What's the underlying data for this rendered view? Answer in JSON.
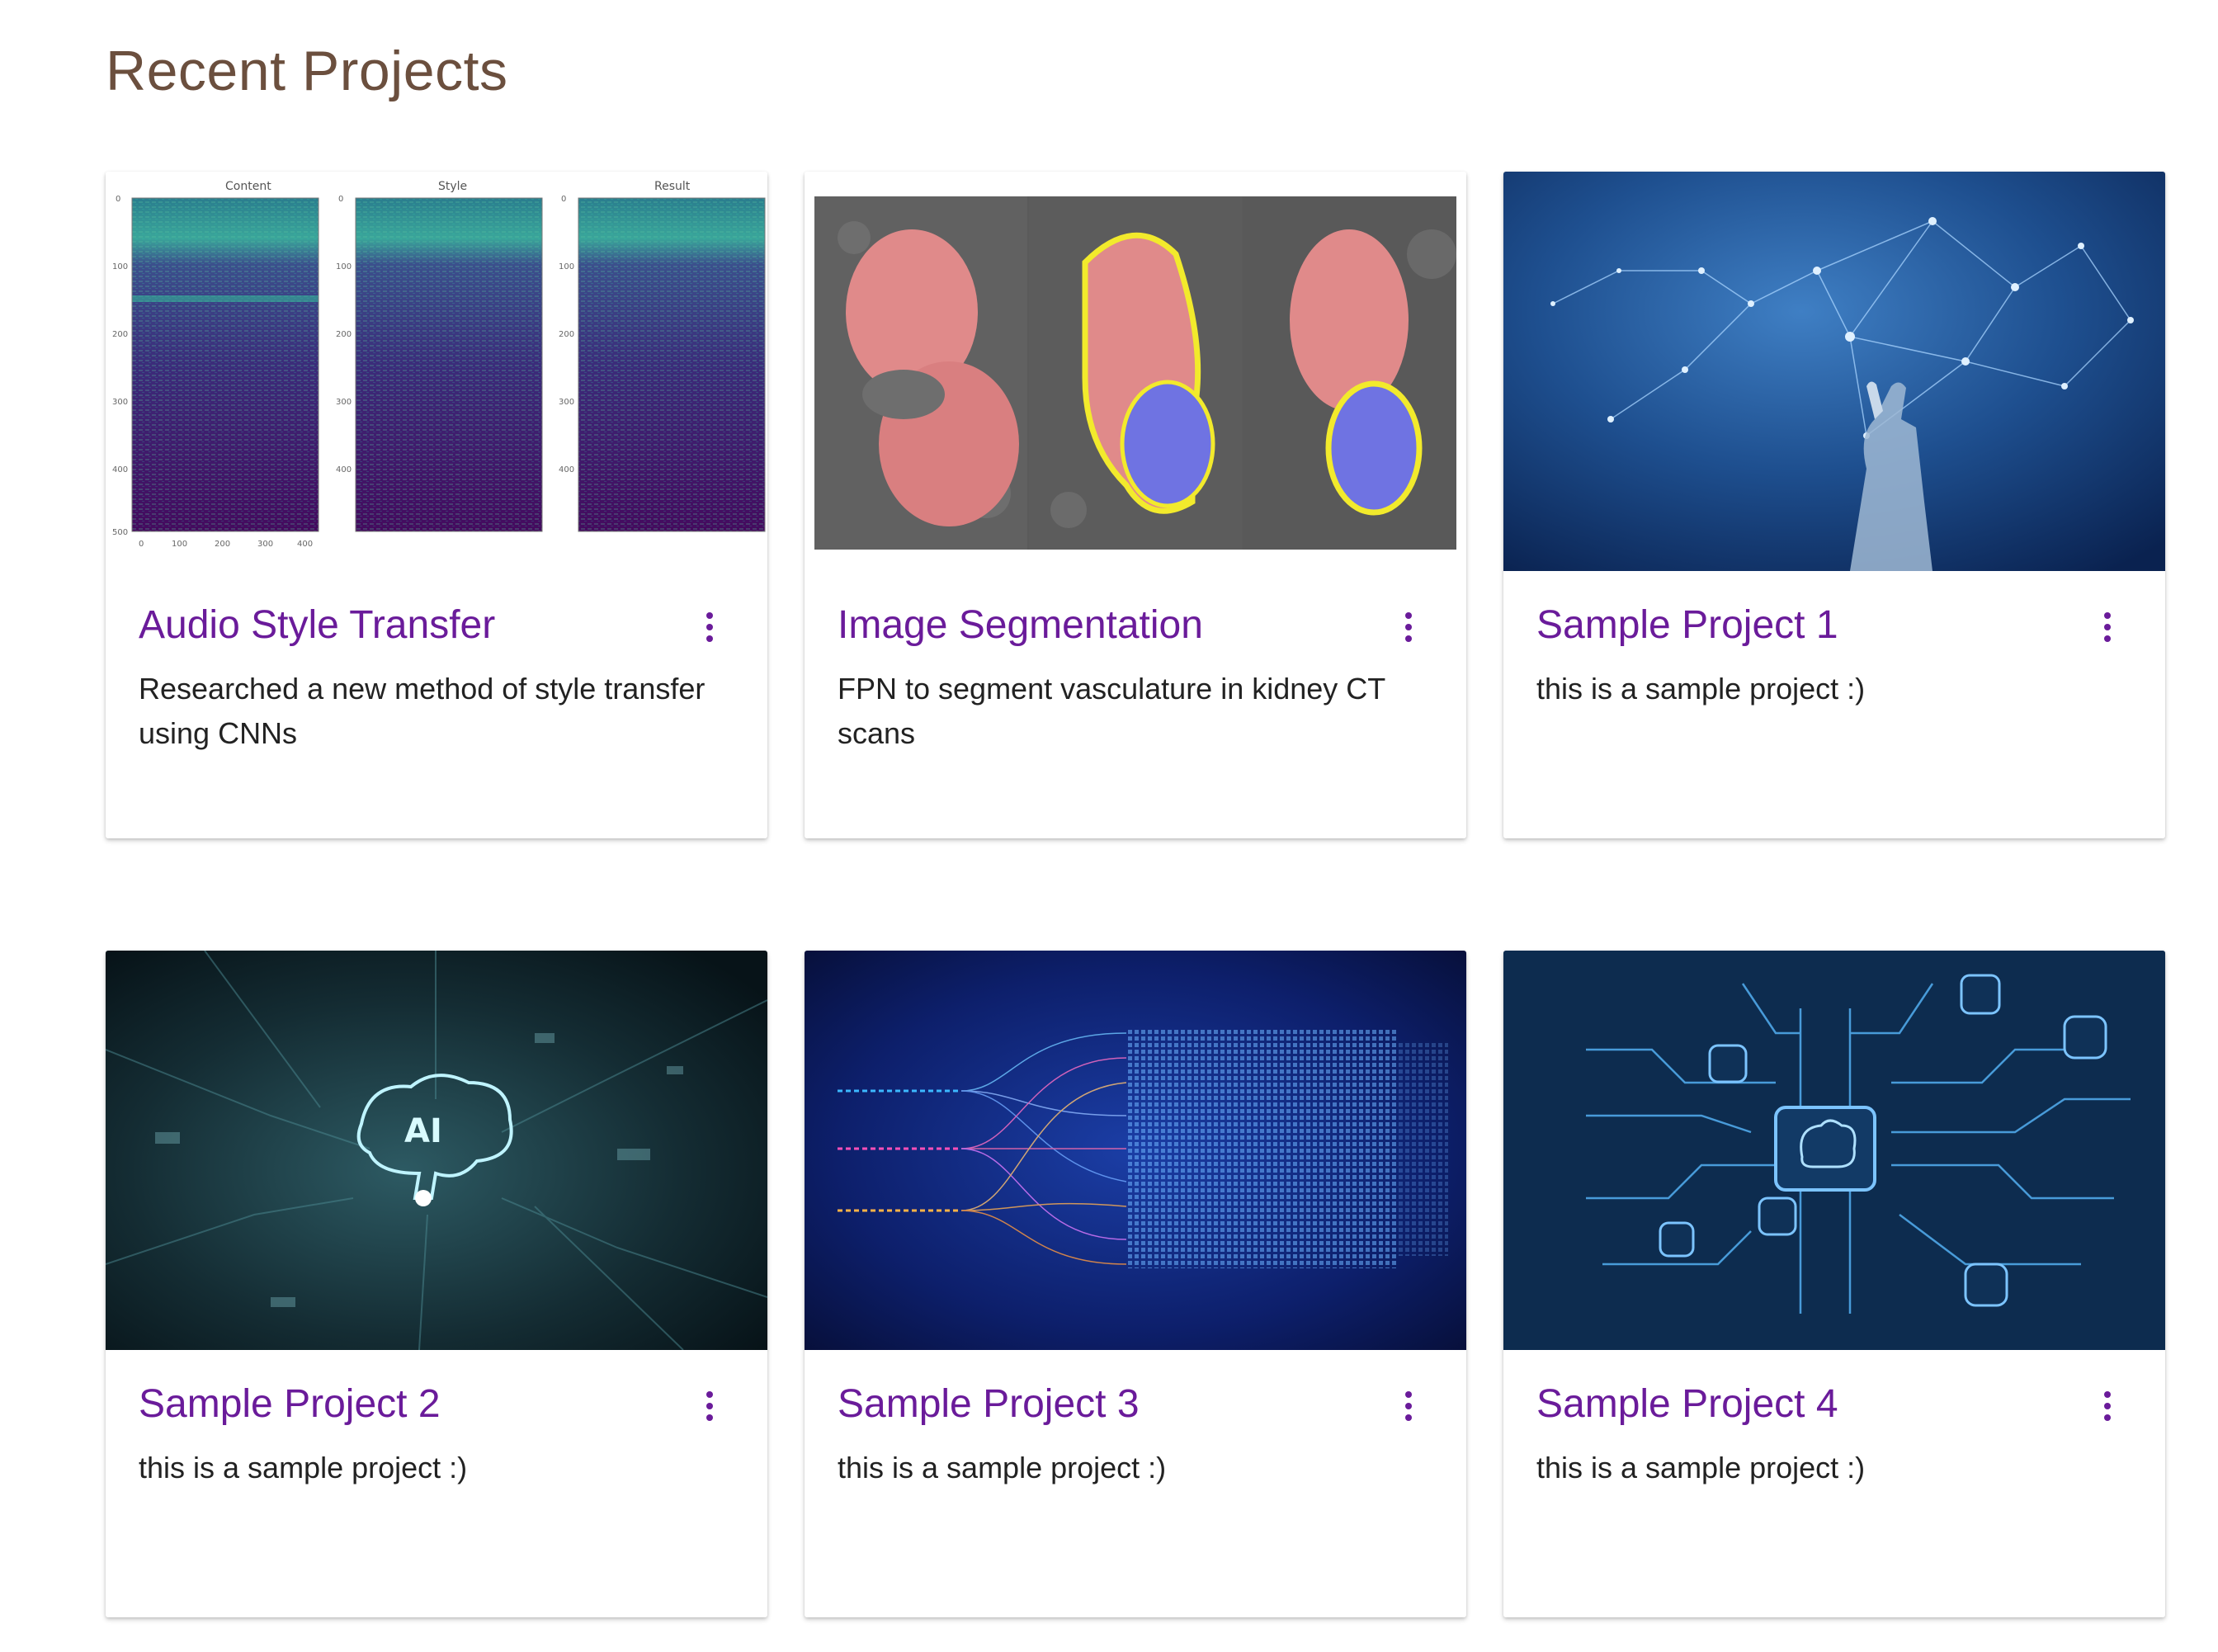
{
  "page": {
    "title": "Recent Projects"
  },
  "colors": {
    "title_text": "#6b4f3e",
    "card_title": "#6a1b9a",
    "card_desc": "#222222",
    "menu_icon": "#6a1b9a"
  },
  "projects": [
    {
      "title": "Audio Style Transfer",
      "description": "Researched a new method of style transfer using CNNs",
      "image": "spectrogram-panels",
      "image_labels": [
        "Content",
        "Style",
        "Result"
      ]
    },
    {
      "title": "Image Segmentation",
      "description": "FPN to segment vasculature in kidney CT scans",
      "image": "kidney-ct-segmentation"
    },
    {
      "title": "Sample Project 1",
      "description": "this is a sample project :)",
      "image": "robot-hand-network"
    },
    {
      "title": "Sample Project 2",
      "description": "this is a sample project :)",
      "image": "ai-brain-circuit"
    },
    {
      "title": "Sample Project 3",
      "description": "this is a sample project :)",
      "image": "data-streams"
    },
    {
      "title": "Sample Project 4",
      "description": "this is a sample project :)",
      "image": "brain-circuit-icons"
    }
  ],
  "icons": {
    "more": "more-vert-icon"
  }
}
